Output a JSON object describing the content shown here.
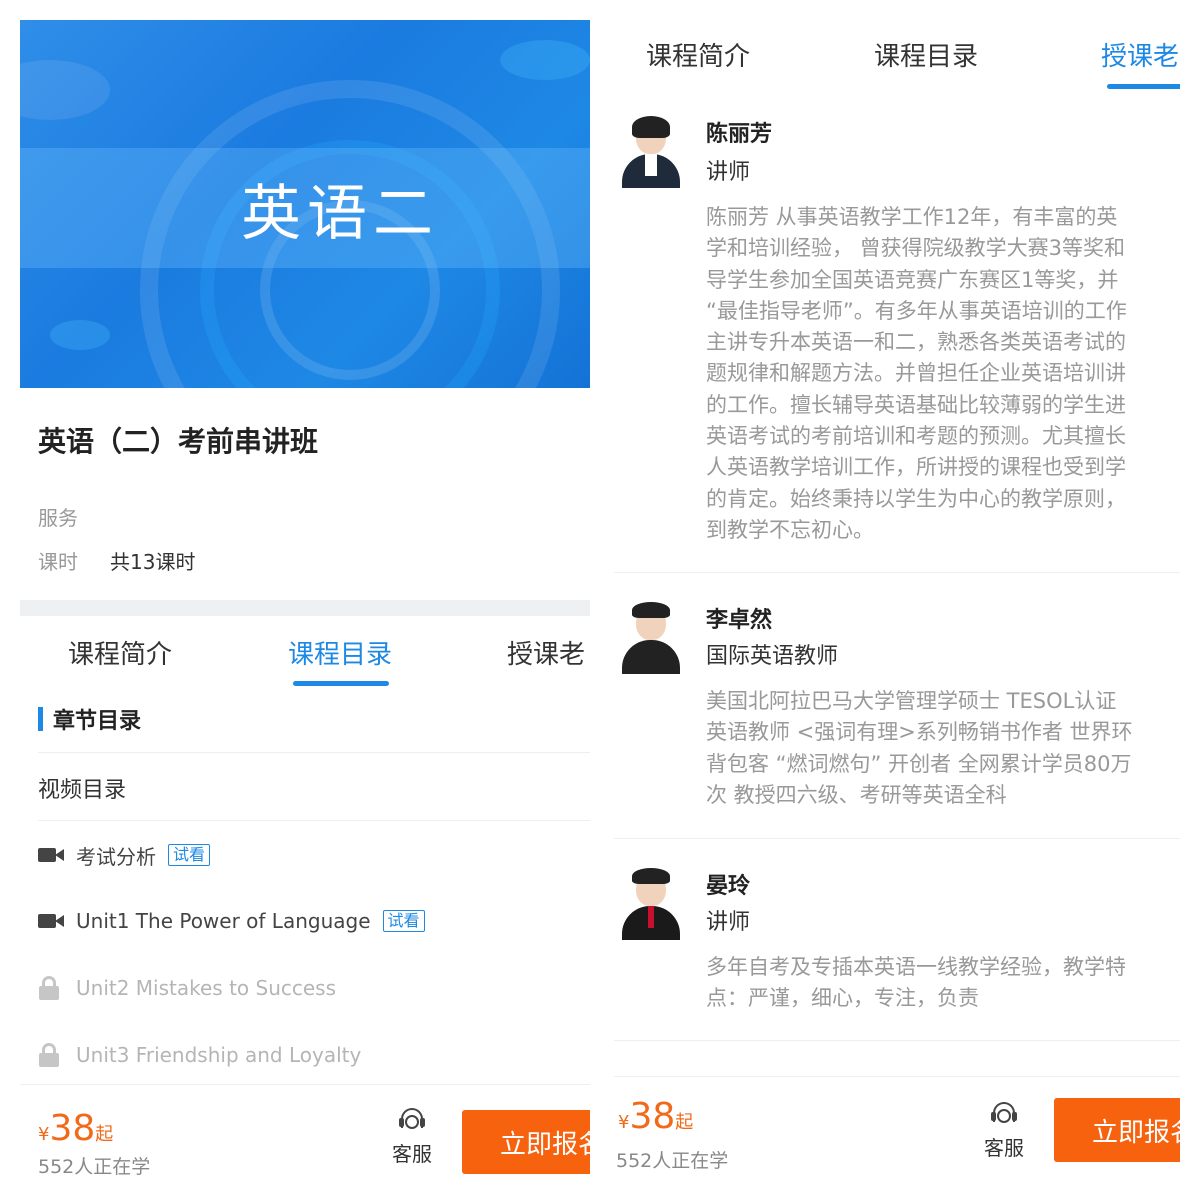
{
  "left": {
    "banner_title": "英语二",
    "course_title": "英语（二）考前串讲班",
    "service_label": "服务",
    "hours_label": "课时",
    "hours_value": "共13课时",
    "tabs": [
      "课程简介",
      "课程目录",
      "授课老"
    ],
    "active_tab": 1,
    "section_title": "章节目录",
    "video_category": "视频目录",
    "lessons": [
      {
        "title": "考试分析",
        "badge": "试看",
        "icon": "video-camera-icon",
        "locked": false
      },
      {
        "title": "Unit1 The Power of Language",
        "badge": "试看",
        "icon": "video-camera-icon",
        "locked": false
      },
      {
        "title": "Unit2 Mistakes to Success",
        "badge": "",
        "icon": "lock-icon",
        "locked": true
      },
      {
        "title": "Unit3 Friendship and Loyalty",
        "badge": "",
        "icon": "lock-icon",
        "locked": true
      }
    ],
    "bottom": {
      "currency": "¥",
      "price": "38",
      "price_suffix": "起",
      "learners": "552人正在学",
      "service": "客服",
      "cta": "立即报名"
    }
  },
  "right": {
    "tabs": [
      "课程简介",
      "课程目录",
      "授课老"
    ],
    "active_tab": 2,
    "teachers": [
      {
        "name": "陈丽芳",
        "role": "讲师",
        "bio_lines": [
          "陈丽芳 从事英语教学工作12年，有丰富的英",
          "学和培训经验， 曾获得院级教学大赛3等奖和",
          "导学生参加全国英语竞赛广东赛区1等奖，并",
          "“最佳指导老师”。有多年从事英语培训的工作",
          "主讲专升本英语一和二，熟悉各类英语考试的",
          "题规律和解题方法。并曾担任企业英语培训讲",
          "的工作。擅长辅导英语基础比较薄弱的学生进",
          "英语考试的考前培训和考题的预测。尤其擅长",
          "人英语教学培训工作，所讲授的课程也受到学",
          "的肯定。始终秉持以学生为中心的教学原则，",
          "到教学不忘初心。"
        ]
      },
      {
        "name": "李卓然",
        "role": "国际英语教师",
        "bio_lines": [
          "美国北阿拉巴马大学管理学硕士 TESOL认证",
          "英语教师 <强词有理>系列畅销书作者 世界环",
          "背包客 “燃词燃句” 开创者 全网累计学员80万",
          "次 教授四六级、考研等英语全科"
        ]
      },
      {
        "name": "晏玲",
        "role": "讲师",
        "bio_lines": [
          "多年自考及专插本英语一线教学经验，教学特",
          "点：严谨，细心，专注，负责"
        ]
      }
    ],
    "bottom": {
      "currency": "¥",
      "price": "38",
      "price_suffix": "起",
      "learners": "552人正在学",
      "service": "客服",
      "cta": "立即报名"
    }
  },
  "colors": {
    "accent": "#1e88e5",
    "price": "#f06a1a",
    "cta": "#f7620f",
    "muted": "#999999"
  }
}
